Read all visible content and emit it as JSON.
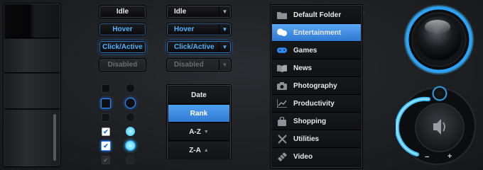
{
  "buttons": [
    {
      "label": "Idle",
      "state": "idle"
    },
    {
      "label": "Hover",
      "state": "hover"
    },
    {
      "label": "Click/Active",
      "state": "active"
    },
    {
      "label": "Disabled",
      "state": "disabled"
    }
  ],
  "dropdowns": [
    {
      "label": "Idle",
      "state": "idle"
    },
    {
      "label": "Hover",
      "state": "hover"
    },
    {
      "label": "Click/Active",
      "state": "active"
    },
    {
      "label": "Disabled",
      "state": "disabled"
    }
  ],
  "sort_menu": {
    "items": [
      {
        "label": "Date",
        "selected": false,
        "indicator": ""
      },
      {
        "label": "Rank",
        "selected": true,
        "indicator": ""
      },
      {
        "label": "A-Z",
        "selected": false,
        "indicator": "▼"
      },
      {
        "label": "Z-A",
        "selected": false,
        "indicator": "▲"
      }
    ]
  },
  "category_menu": {
    "items": [
      {
        "label": "Default Folder",
        "icon": "folder-icon",
        "selected": false
      },
      {
        "label": "Entertainment",
        "icon": "theater-masks-icon",
        "selected": true
      },
      {
        "label": "Games",
        "icon": "gamepad-icon",
        "selected": false
      },
      {
        "label": "News",
        "icon": "book-icon",
        "selected": false
      },
      {
        "label": "Photography",
        "icon": "camera-icon",
        "selected": false
      },
      {
        "label": "Productivity",
        "icon": "chart-line-icon",
        "selected": false
      },
      {
        "label": "Shopping",
        "icon": "shopping-bag-icon",
        "selected": false
      },
      {
        "label": "Utilities",
        "icon": "tools-icon",
        "selected": false
      },
      {
        "label": "Video",
        "icon": "video-icon",
        "selected": false
      }
    ]
  },
  "volume": {
    "minus": "−",
    "plus": "+"
  },
  "colors": {
    "accent": "#2e8cff",
    "selected": "#3f8ee5",
    "glow": "#38b6ff"
  }
}
